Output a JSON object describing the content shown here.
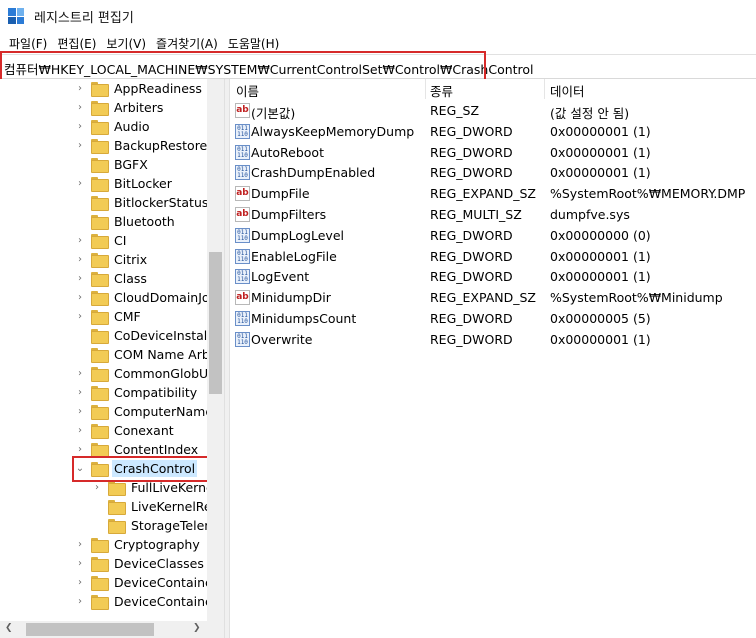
{
  "window": {
    "title": "레지스트리 편집기",
    "icon": "regedit-icon"
  },
  "menu": [
    {
      "label": "파일(F)"
    },
    {
      "label": "편집(E)"
    },
    {
      "label": "보기(V)"
    },
    {
      "label": "즐겨찾기(A)"
    },
    {
      "label": "도움말(H)"
    }
  ],
  "address": {
    "path": "컴퓨터₩HKEY_LOCAL_MACHINE₩SYSTEM₩CurrentControlSet₩Control₩CrashControl"
  },
  "tree": {
    "items": [
      {
        "label": "AppReadiness",
        "expander": "›",
        "depth": 0
      },
      {
        "label": "Arbiters",
        "expander": "›",
        "depth": 0
      },
      {
        "label": "Audio",
        "expander": "›",
        "depth": 0
      },
      {
        "label": "BackupRestore",
        "expander": "›",
        "depth": 0
      },
      {
        "label": "BGFX",
        "expander": "",
        "depth": 0
      },
      {
        "label": "BitLocker",
        "expander": "›",
        "depth": 0
      },
      {
        "label": "BitlockerStatus",
        "expander": "",
        "depth": 0
      },
      {
        "label": "Bluetooth",
        "expander": "",
        "depth": 0
      },
      {
        "label": "CI",
        "expander": "›",
        "depth": 0
      },
      {
        "label": "Citrix",
        "expander": "›",
        "depth": 0
      },
      {
        "label": "Class",
        "expander": "›",
        "depth": 0
      },
      {
        "label": "CloudDomainJoin",
        "expander": "›",
        "depth": 0
      },
      {
        "label": "CMF",
        "expander": "›",
        "depth": 0
      },
      {
        "label": "CoDeviceInstallers",
        "expander": "",
        "depth": 0
      },
      {
        "label": "COM Name Arbite",
        "expander": "",
        "depth": 0
      },
      {
        "label": "CommonGlobUser",
        "expander": "›",
        "depth": 0
      },
      {
        "label": "Compatibility",
        "expander": "›",
        "depth": 0
      },
      {
        "label": "ComputerName",
        "expander": "›",
        "depth": 0
      },
      {
        "label": "Conexant",
        "expander": "›",
        "depth": 0
      },
      {
        "label": "ContentIndex",
        "expander": "›",
        "depth": 0
      },
      {
        "label": "CrashControl",
        "expander": "⌄",
        "depth": 0,
        "selected": true
      },
      {
        "label": "FullLiveKernelRe",
        "expander": "›",
        "depth": 1
      },
      {
        "label": "LiveKernelRepo",
        "expander": "",
        "depth": 1
      },
      {
        "label": "StorageTelemet",
        "expander": "",
        "depth": 1
      },
      {
        "label": "Cryptography",
        "expander": "›",
        "depth": 0
      },
      {
        "label": "DeviceClasses",
        "expander": "›",
        "depth": 0
      },
      {
        "label": "DeviceContainerPr",
        "expander": "›",
        "depth": 0
      },
      {
        "label": "DeviceContainers",
        "expander": "›",
        "depth": 0
      }
    ]
  },
  "list": {
    "columns": {
      "name": "이름",
      "type": "종류",
      "data": "데이터"
    },
    "rows": [
      {
        "icon": "ab",
        "name": "(기본값)",
        "type": "REG_SZ",
        "data": "(값 설정 안 됨)"
      },
      {
        "icon": "bin",
        "name": "AlwaysKeepMemoryDump",
        "type": "REG_DWORD",
        "data": "0x00000001 (1)"
      },
      {
        "icon": "bin",
        "name": "AutoReboot",
        "type": "REG_DWORD",
        "data": "0x00000001 (1)"
      },
      {
        "icon": "bin",
        "name": "CrashDumpEnabled",
        "type": "REG_DWORD",
        "data": "0x00000001 (1)"
      },
      {
        "icon": "ab",
        "name": "DumpFile",
        "type": "REG_EXPAND_SZ",
        "data": "%SystemRoot%₩MEMORY.DMP"
      },
      {
        "icon": "ab",
        "name": "DumpFilters",
        "type": "REG_MULTI_SZ",
        "data": "dumpfve.sys"
      },
      {
        "icon": "bin",
        "name": "DumpLogLevel",
        "type": "REG_DWORD",
        "data": "0x00000000 (0)"
      },
      {
        "icon": "bin",
        "name": "EnableLogFile",
        "type": "REG_DWORD",
        "data": "0x00000001 (1)"
      },
      {
        "icon": "bin",
        "name": "LogEvent",
        "type": "REG_DWORD",
        "data": "0x00000001 (1)"
      },
      {
        "icon": "ab",
        "name": "MinidumpDir",
        "type": "REG_EXPAND_SZ",
        "data": "%SystemRoot%₩Minidump"
      },
      {
        "icon": "bin",
        "name": "MinidumpsCount",
        "type": "REG_DWORD",
        "data": "0x00000005 (5)"
      },
      {
        "icon": "bin",
        "name": "Overwrite",
        "type": "REG_DWORD",
        "data": "0x00000001 (1)"
      }
    ]
  },
  "colors": {
    "highlight_box": "#d62a2a",
    "selection": "#cce8ff",
    "folder": "#f2cb55"
  }
}
